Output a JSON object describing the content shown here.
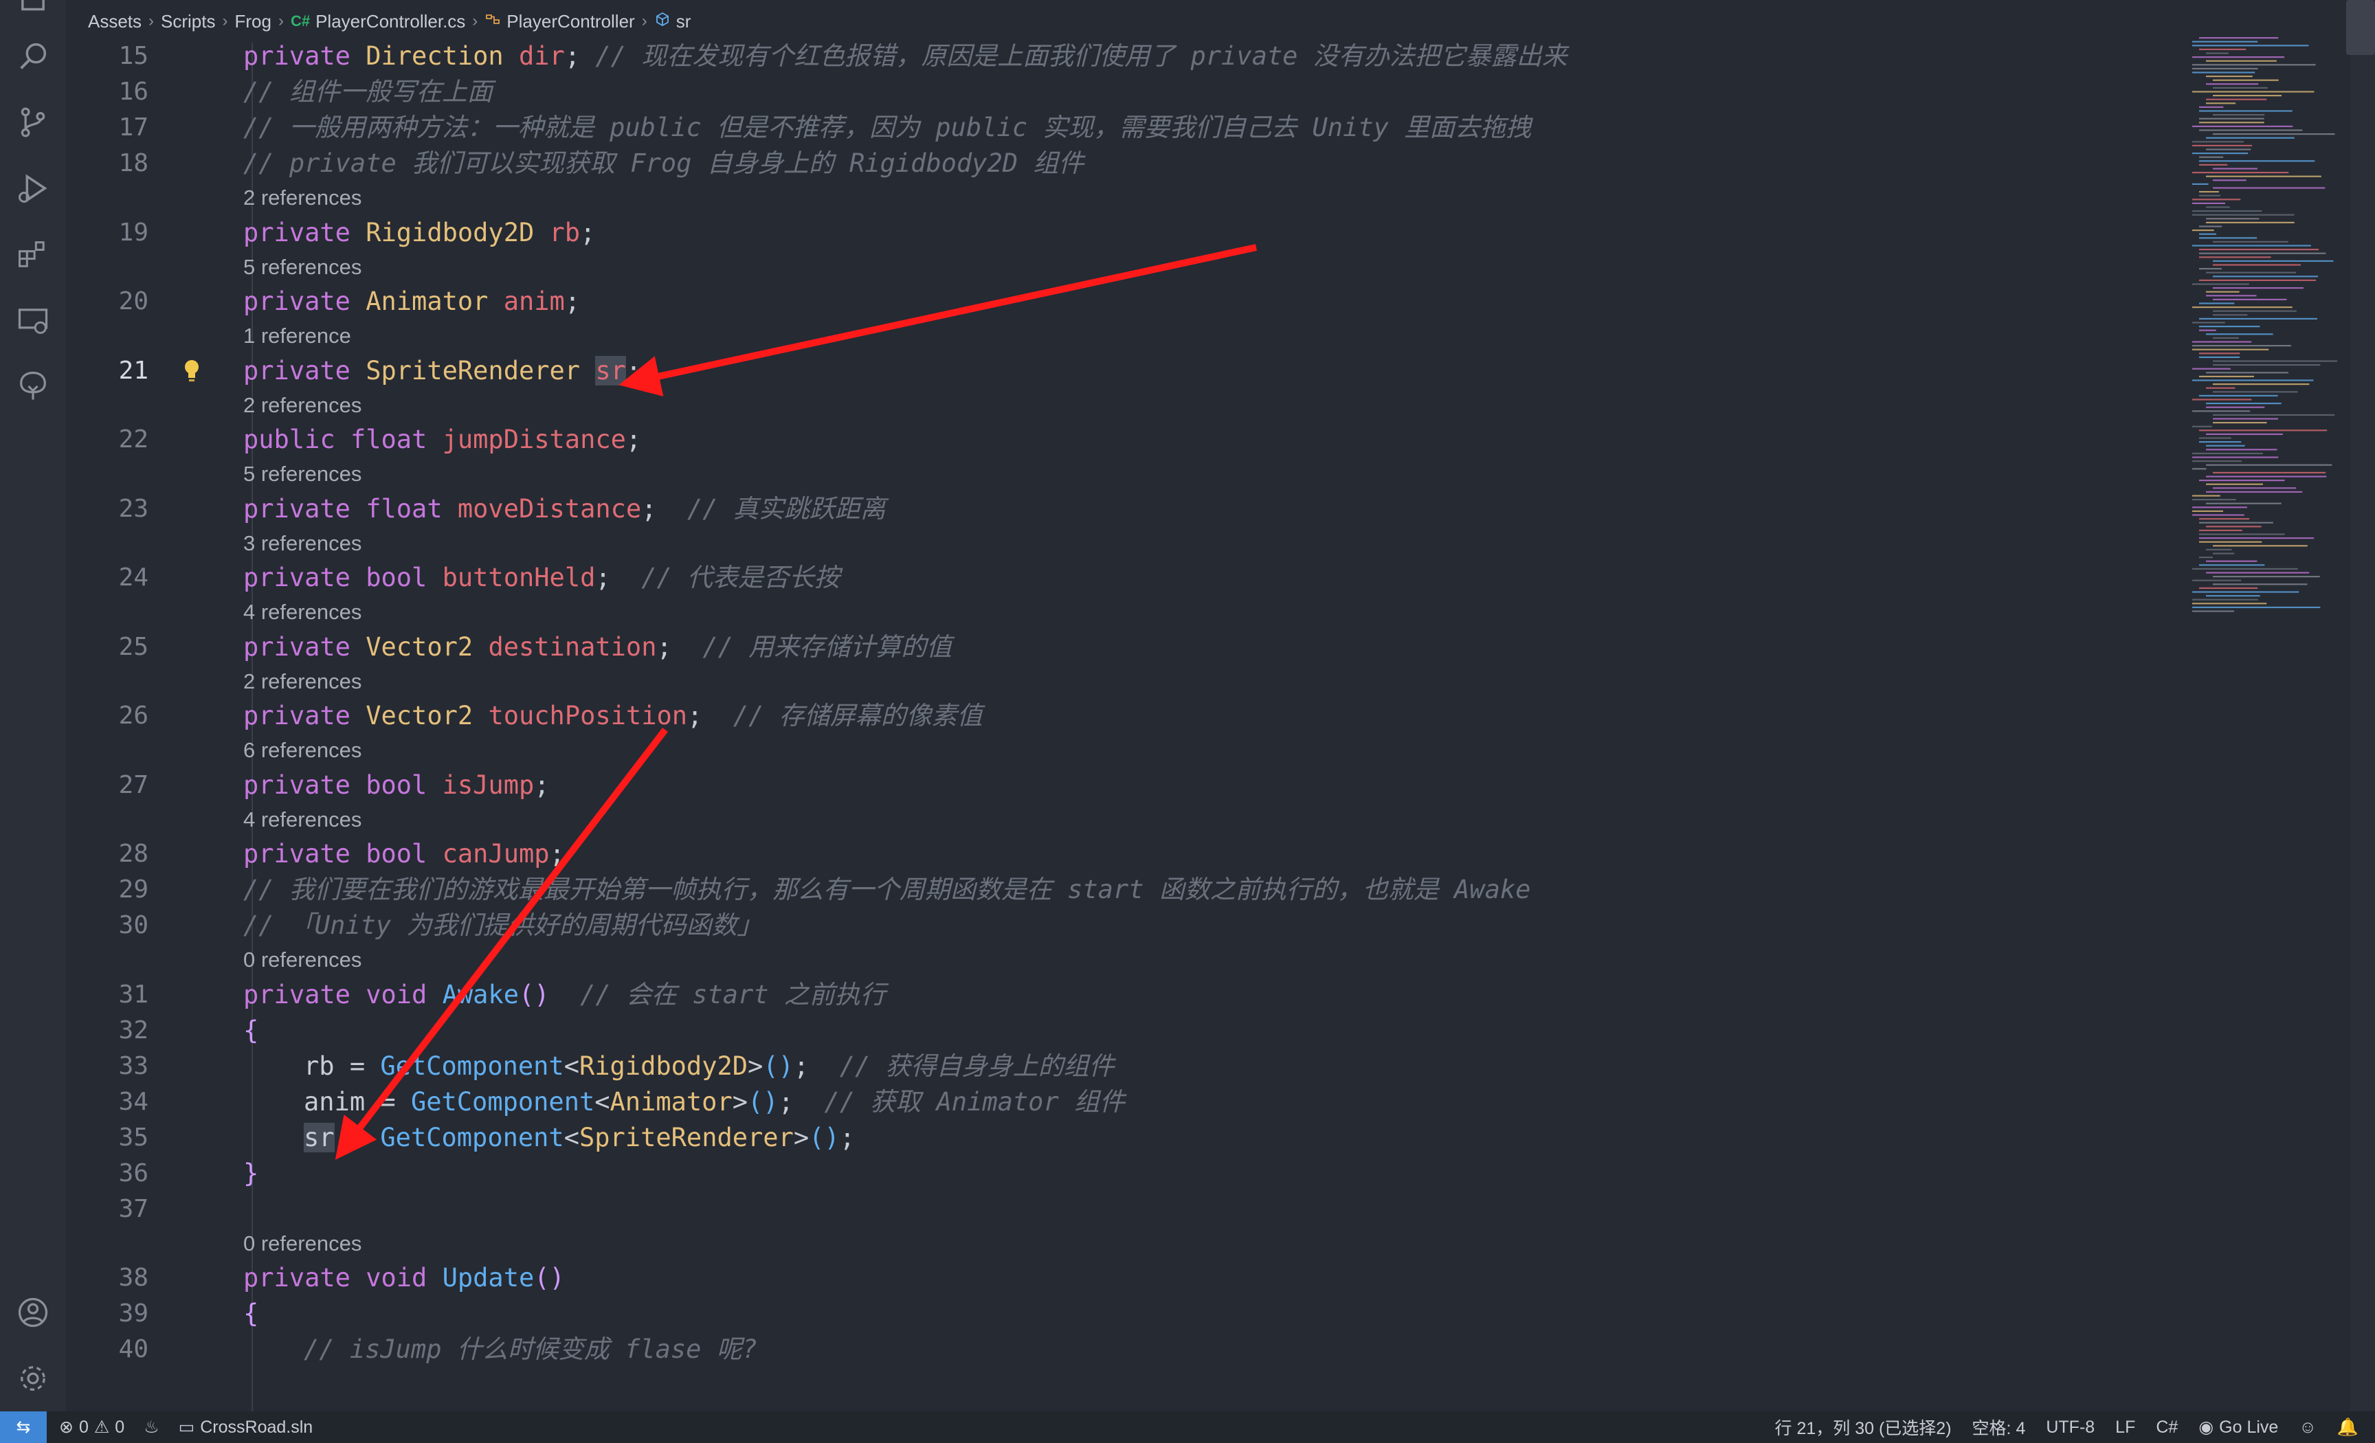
{
  "breadcrumb": {
    "items": [
      "Assets",
      "Scripts",
      "Frog",
      "PlayerController.cs",
      "PlayerController",
      "sr"
    ],
    "file_icon": "C#"
  },
  "code": {
    "rows": [
      {
        "kind": "code",
        "ln": "15",
        "tokens": [
          [
            "kw",
            "private "
          ],
          [
            "ty",
            "Direction "
          ],
          [
            "id",
            "dir"
          ],
          [
            "pu",
            "; "
          ],
          [
            "cm",
            "// 现在发现有个红色报错，原因是上面我们使用了 private 没有办法把它暴露出来"
          ]
        ]
      },
      {
        "kind": "code",
        "ln": "16",
        "tokens": [
          [
            "cm",
            "// 组件一般写在上面"
          ]
        ]
      },
      {
        "kind": "code",
        "ln": "17",
        "tokens": [
          [
            "cm",
            "// 一般用两种方法：一种就是 public 但是不推荐，因为 public 实现，需要我们自己去 Unity 里面去拖拽"
          ]
        ]
      },
      {
        "kind": "code",
        "ln": "18",
        "tokens": [
          [
            "cm",
            "// private 我们可以实现获取 Frog 自身身上的 Rigidbody2D 组件"
          ]
        ]
      },
      {
        "kind": "lens",
        "text": "2 references"
      },
      {
        "kind": "code",
        "ln": "19",
        "tokens": [
          [
            "kw",
            "private "
          ],
          [
            "ty",
            "Rigidbody2D "
          ],
          [
            "id",
            "rb"
          ],
          [
            "pu",
            ";"
          ]
        ]
      },
      {
        "kind": "lens",
        "text": "5 references"
      },
      {
        "kind": "code",
        "ln": "20",
        "tokens": [
          [
            "kw",
            "private "
          ],
          [
            "ty",
            "Animator "
          ],
          [
            "id",
            "anim"
          ],
          [
            "pu",
            ";"
          ]
        ]
      },
      {
        "kind": "lens",
        "text": "1 reference"
      },
      {
        "kind": "code",
        "ln": "21",
        "active": true,
        "bulb": true,
        "tokens": [
          [
            "kw",
            "private "
          ],
          [
            "ty",
            "SpriteRenderer "
          ],
          [
            "id hl",
            "sr"
          ],
          [
            "pu",
            ";"
          ]
        ]
      },
      {
        "kind": "lens",
        "text": "2 references"
      },
      {
        "kind": "code",
        "ln": "22",
        "tokens": [
          [
            "kw",
            "public "
          ],
          [
            "kw",
            "float "
          ],
          [
            "id",
            "jumpDistance"
          ],
          [
            "pu",
            ";"
          ]
        ]
      },
      {
        "kind": "lens",
        "text": "5 references"
      },
      {
        "kind": "code",
        "ln": "23",
        "tokens": [
          [
            "kw",
            "private "
          ],
          [
            "kw",
            "float "
          ],
          [
            "id",
            "moveDistance"
          ],
          [
            "pu",
            ";  "
          ],
          [
            "cm",
            "// 真实跳跃距离"
          ]
        ]
      },
      {
        "kind": "lens",
        "text": "3 references"
      },
      {
        "kind": "code",
        "ln": "24",
        "tokens": [
          [
            "kw",
            "private "
          ],
          [
            "kw",
            "bool "
          ],
          [
            "id",
            "buttonHeld"
          ],
          [
            "pu",
            ";  "
          ],
          [
            "cm",
            "// 代表是否长按"
          ]
        ]
      },
      {
        "kind": "lens",
        "text": "4 references"
      },
      {
        "kind": "code",
        "ln": "25",
        "tokens": [
          [
            "kw",
            "private "
          ],
          [
            "ty",
            "Vector2 "
          ],
          [
            "id",
            "destination"
          ],
          [
            "pu",
            ";  "
          ],
          [
            "cm",
            "// 用来存储计算的值"
          ]
        ]
      },
      {
        "kind": "lens",
        "text": "2 references"
      },
      {
        "kind": "code",
        "ln": "26",
        "tokens": [
          [
            "kw",
            "private "
          ],
          [
            "ty",
            "Vector2 "
          ],
          [
            "id",
            "touchPosition"
          ],
          [
            "pu",
            ";  "
          ],
          [
            "cm",
            "// 存储屏幕的像素值"
          ]
        ]
      },
      {
        "kind": "lens",
        "text": "6 references"
      },
      {
        "kind": "code",
        "ln": "27",
        "tokens": [
          [
            "kw",
            "private "
          ],
          [
            "kw",
            "bool "
          ],
          [
            "id",
            "isJump"
          ],
          [
            "pu",
            ";"
          ]
        ]
      },
      {
        "kind": "lens",
        "text": "4 references"
      },
      {
        "kind": "code",
        "ln": "28",
        "tokens": [
          [
            "kw",
            "private "
          ],
          [
            "kw",
            "bool "
          ],
          [
            "id",
            "canJump"
          ],
          [
            "pu",
            ";"
          ]
        ]
      },
      {
        "kind": "code",
        "ln": "29",
        "tokens": [
          [
            "cm",
            "// 我们要在我们的游戏最最开始第一帧执行，那么有一个周期函数是在 start 函数之前执行的，也就是 Awake"
          ]
        ]
      },
      {
        "kind": "code",
        "ln": "30",
        "tokens": [
          [
            "cm",
            "// 「Unity 为我们提供好的周期代码函数」"
          ]
        ]
      },
      {
        "kind": "lens",
        "text": "0 references"
      },
      {
        "kind": "code",
        "ln": "31",
        "tokens": [
          [
            "kw",
            "private "
          ],
          [
            "kw",
            "void "
          ],
          [
            "fn",
            "Awake"
          ],
          [
            "br",
            "()"
          ],
          [
            "pu",
            "  "
          ],
          [
            "cm",
            "// 会在 start 之前执行"
          ]
        ]
      },
      {
        "kind": "code",
        "ln": "32",
        "tokens": [
          [
            "br",
            "{"
          ]
        ]
      },
      {
        "kind": "code",
        "ln": "33",
        "indent": true,
        "tokens": [
          [
            "pu",
            "rb = "
          ],
          [
            "fn",
            "GetComponent"
          ],
          [
            "pu",
            "<"
          ],
          [
            "ty",
            "Rigidbody2D"
          ],
          [
            "pu",
            ">"
          ],
          [
            "fn",
            "()"
          ],
          [
            "pu",
            ";  "
          ],
          [
            "cm",
            "// 获得自身身上的组件"
          ]
        ]
      },
      {
        "kind": "code",
        "ln": "34",
        "indent": true,
        "tokens": [
          [
            "pu",
            "anim = "
          ],
          [
            "fn",
            "GetComponent"
          ],
          [
            "pu",
            "<"
          ],
          [
            "ty",
            "Animator"
          ],
          [
            "pu",
            ">"
          ],
          [
            "fn",
            "()"
          ],
          [
            "pu",
            ";  "
          ],
          [
            "cm",
            "// 获取 Animator 组件"
          ]
        ]
      },
      {
        "kind": "code",
        "ln": "35",
        "indent": true,
        "tokens": [
          [
            "pu hl",
            "sr"
          ],
          [
            "pu",
            " = "
          ],
          [
            "fn",
            "GetComponent"
          ],
          [
            "pu",
            "<"
          ],
          [
            "ty",
            "SpriteRenderer"
          ],
          [
            "pu",
            ">"
          ],
          [
            "fn",
            "()"
          ],
          [
            "pu",
            ";"
          ]
        ]
      },
      {
        "kind": "code",
        "ln": "36",
        "tokens": [
          [
            "br",
            "}"
          ]
        ]
      },
      {
        "kind": "code",
        "ln": "37",
        "tokens": []
      },
      {
        "kind": "lens",
        "text": "0 references"
      },
      {
        "kind": "code",
        "ln": "38",
        "tokens": [
          [
            "kw",
            "private "
          ],
          [
            "kw",
            "void "
          ],
          [
            "fn",
            "Update"
          ],
          [
            "br",
            "()"
          ]
        ]
      },
      {
        "kind": "code",
        "ln": "39",
        "tokens": [
          [
            "br",
            "{"
          ]
        ]
      },
      {
        "kind": "code",
        "ln": "40",
        "indent": true,
        "tokens": [
          [
            "cm",
            "// isJump 什么时候变成 flase 呢?"
          ]
        ]
      }
    ]
  },
  "statusbar": {
    "errors": "0",
    "warnings": "0",
    "solution": "CrossRoad.sln",
    "position": "行 21，列 30 (已选择2)",
    "spaces": "空格: 4",
    "encoding": "UTF-8",
    "eol": "LF",
    "language": "C#",
    "golive": "Go Live"
  },
  "icons": {
    "activity": [
      "explorer-icon",
      "search-icon",
      "source-control-icon",
      "run-debug-icon",
      "extensions-icon",
      "remote-explorer-icon",
      "tree-icon",
      "account-icon",
      "gear-icon"
    ]
  },
  "colors": {
    "keyword": "#c678dd",
    "type": "#e5c07b",
    "identifier": "#e06c75",
    "function": "#61afef",
    "comment": "#6b717c",
    "annotation_arrow": "#ff1a1a",
    "remote_indicator": "#3f86d6"
  }
}
